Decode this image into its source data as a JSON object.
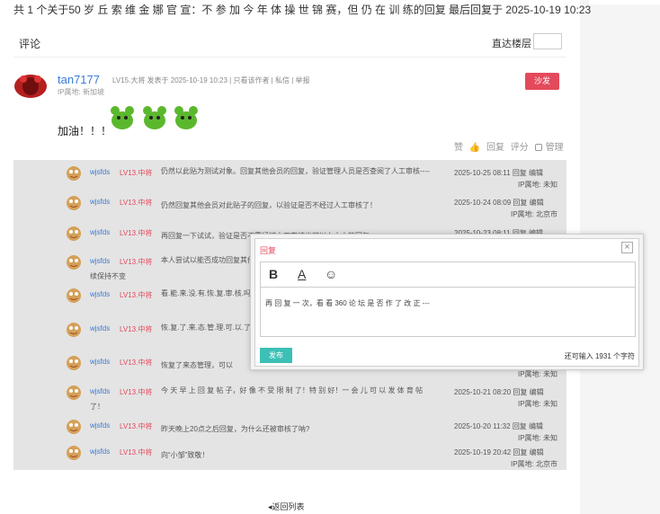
{
  "topline": "共 1 个关于50 岁 丘 索 维 金 娜 官 宣：不 参 加 今 年 体 操 世 锦 赛，但 仍 在 训 练的回复 最后回复于 2025-10-19 10:23",
  "header": {
    "label": "评论",
    "jump_label": "直达楼层",
    "jump_value": ""
  },
  "post": {
    "author": "tan7177",
    "meta": "LV15.大将  发表于 2025-10-19 10:23  |  只看该作者  |  私信  |  举报",
    "ip": "IP属地: 新加坡",
    "sofa_label": "沙发",
    "text": "加油！！！",
    "actions": {
      "zan": "赞",
      "reply": "回复",
      "rate": "评分",
      "admin": "管理"
    }
  },
  "replies": [
    {
      "name": "wjsfds",
      "level": "LV13.中将",
      "text": "仍然以此贴为测试对象。回复其他会员的回复，验证管理人员是否查阅了人工审核----",
      "date": "2025-10-25 08:11",
      "actions": "回复 编辑",
      "loc": "IP属地: 未知",
      "wrap": true
    },
    {
      "name": "wjsfds",
      "level": "LV13.中将",
      "text": "仍然回复其他会员对此贴子的回复，以验证是否不经过人工审核了！",
      "date": "2025-10-24 08:09",
      "actions": "回复 编辑",
      "loc": "IP属地: 北京市",
      "wrap": false
    },
    {
      "name": "wjsfds",
      "level": "LV13.中将",
      "text": "再回复一下试试，验证是否不需经过人工审核也可以上大人的回复",
      "date": "2025-10-23 08:11",
      "actions": "回复 编辑",
      "loc": "",
      "wrap": false
    },
    {
      "name": "wjsfds",
      "level": "LV13.中将",
      "text": "本人尝试以能否成功回复其他会员的回复，结果仍然要经过人工审核才能够显示，则继续保持不变",
      "date": "",
      "actions": "",
      "loc": "",
      "wrap": true
    },
    {
      "name": "wjsfds",
      "level": "LV13.中将",
      "text": "看.能.来.没.有.恢.复.审.核.吗.？！",
      "date": "",
      "actions": "",
      "loc": "",
      "wrap": true
    },
    {
      "name": "wjsfds",
      "level": "LV13.中将",
      "text": "恢.复.了.来.态.管.理.可.以.了.吗.？！",
      "date": "",
      "actions": "",
      "loc": "",
      "wrap": true
    },
    {
      "name": "wjsfds",
      "level": "LV13.中将",
      "text": "恢复了来态管理，可以",
      "date": "",
      "actions": "",
      "loc": "IP属地: 未知",
      "wrap": false
    },
    {
      "name": "wjsfds",
      "level": "LV13.中将",
      "text": "今 天 早 上 回 复 帖 子，好 像 不 受 限 制 了！特 别 好！一 会 儿 可 以 发 体 育 帖 了！",
      "date": "2025-10-21 08:20",
      "actions": "回复 编辑",
      "loc": "IP属地: 未知",
      "wrap": true
    },
    {
      "name": "wjsfds",
      "level": "LV13.中将",
      "text": "昨天晚上20点之后回复，为什么还被审核了呐?",
      "date": "2025-10-20 11:32",
      "actions": "回复 编辑",
      "loc": "IP属地: 未知",
      "wrap": false
    },
    {
      "name": "wjsfds",
      "level": "LV13.中将",
      "text": "向“小邹”致敬！",
      "date": "2025-10-19 20:42",
      "actions": "回复 编辑",
      "loc": "IP属地: 北京市",
      "wrap": false
    }
  ],
  "modal": {
    "title": "回复",
    "close": "×",
    "toolbar": {
      "bold": "B",
      "underline": "A",
      "emoji": "☺"
    },
    "content": "再 回 复 一 次，看 看 360 论 坛 是 否 作 了 改 正 ---",
    "publish": "发布",
    "remaining": "还可输入 1931 个字符"
  },
  "back_link": "◂返回列表",
  "colors": {
    "accent": "#3cc0b5",
    "danger": "#e34a5c",
    "link": "#3a7bd5"
  }
}
